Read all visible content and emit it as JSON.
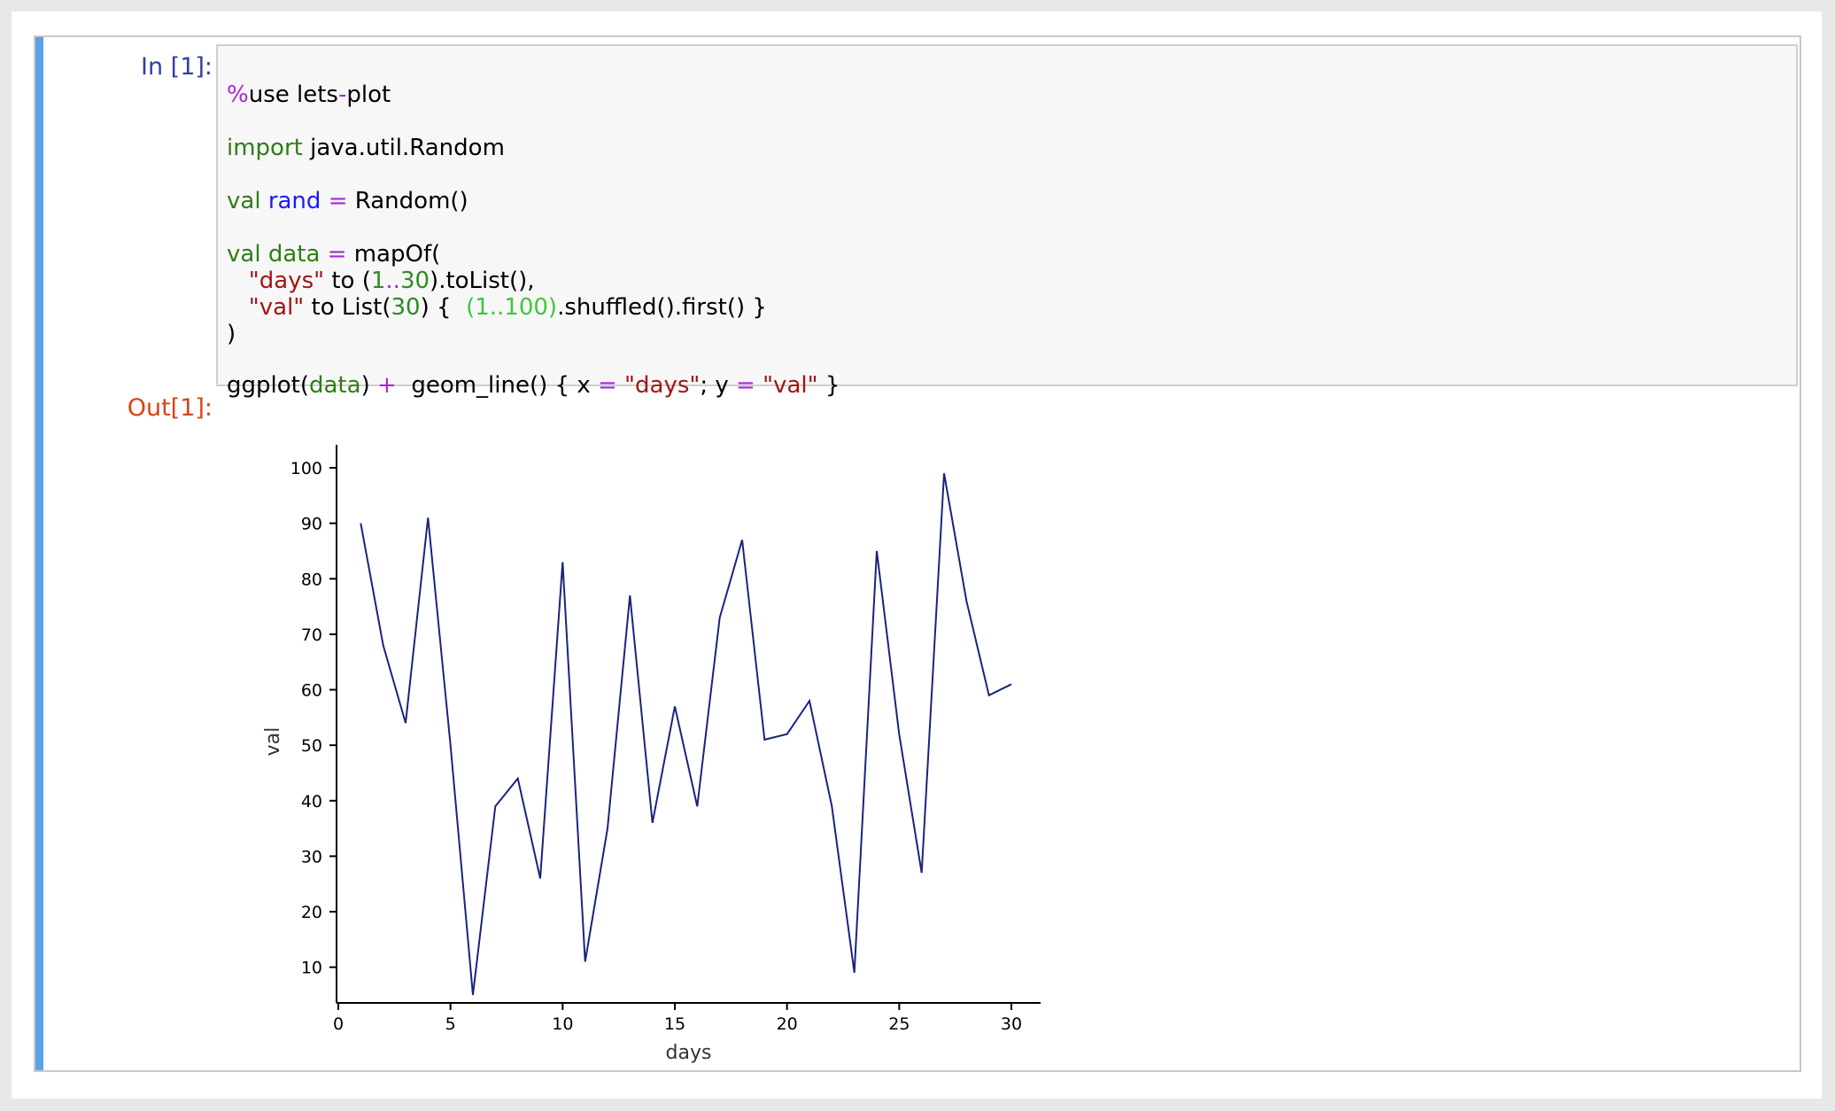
{
  "cell": {
    "in_prompt": "In [1]:",
    "out_prompt": "Out[1]:"
  },
  "code": {
    "line1_a": "%",
    "line1_b": "use lets",
    "line1_c": "-",
    "line1_d": "plot",
    "line2_a": "import",
    "line2_b": " java.util.Random",
    "line3_a": "val",
    "line3_b": "rand",
    "line3_c": "=",
    "line3_d": "Random()",
    "line4_a": "val",
    "line4_b": "data",
    "line4_c": "=",
    "line4_d": "mapOf(",
    "line5_a": "\"days\"",
    "line5_b": " to (",
    "line5_c": "1",
    "line5_d": "..",
    "line5_e": "30",
    "line5_f": ").toList(),",
    "line6_a": "\"val\"",
    "line6_b": " to List(",
    "line6_c": "30",
    "line6_d": ") {  ",
    "line6_e": "(1..100)",
    "line6_f": ".shuffled().first() }",
    "line7": ")",
    "line8_a": "ggplot(",
    "line8_b": "data",
    "line8_c": ")",
    "line8_d": "+",
    "line8_e": "geom_line() { x",
    "line8_f": "=",
    "line8_g": "\"days\"",
    "line8_h": "; y",
    "line8_i": "=",
    "line8_j": "\"val\"",
    "line8_k": " }"
  },
  "colors": {
    "line": "#1a237e",
    "accent_bar": "#5aa2ea"
  },
  "chart_data": {
    "type": "line",
    "xlabel": "days",
    "ylabel": "val",
    "xlim": [
      0,
      30
    ],
    "ylim": [
      5,
      100
    ],
    "xticks": [
      0,
      5,
      10,
      15,
      20,
      25,
      30
    ],
    "yticks": [
      10,
      20,
      30,
      40,
      50,
      60,
      70,
      80,
      90,
      100
    ],
    "grid": false,
    "x": [
      1,
      2,
      3,
      4,
      5,
      6,
      7,
      8,
      9,
      10,
      11,
      12,
      13,
      14,
      15,
      16,
      17,
      18,
      19,
      20,
      21,
      22,
      23,
      24,
      25,
      26,
      27,
      28,
      29,
      30
    ],
    "y": [
      90,
      68,
      54,
      91,
      50,
      5,
      39,
      44,
      26,
      83,
      11,
      35,
      77,
      36,
      57,
      39,
      73,
      87,
      51,
      52,
      58,
      39,
      9,
      85,
      52,
      27,
      99,
      76,
      59,
      61
    ]
  }
}
